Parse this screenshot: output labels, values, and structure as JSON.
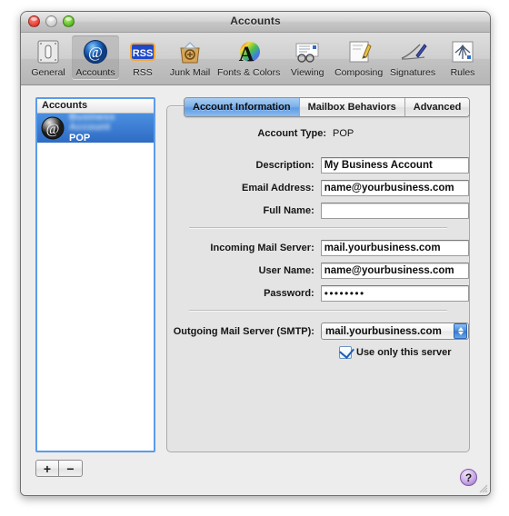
{
  "window": {
    "title": "Accounts",
    "traffic": {
      "close": "close-button",
      "minimize": "minimize-button",
      "zoom": "zoom-button"
    }
  },
  "toolbar": {
    "items": [
      {
        "label": "General",
        "icon": "general-icon",
        "selected": false
      },
      {
        "label": "Accounts",
        "icon": "accounts-at-icon",
        "selected": true
      },
      {
        "label": "RSS",
        "icon": "rss-icon",
        "selected": false
      },
      {
        "label": "Junk Mail",
        "icon": "junk-mail-icon",
        "selected": false
      },
      {
        "label": "Fonts & Colors",
        "icon": "fonts-colors-icon",
        "selected": false
      },
      {
        "label": "Viewing",
        "icon": "viewing-icon",
        "selected": false
      },
      {
        "label": "Composing",
        "icon": "composing-icon",
        "selected": false
      },
      {
        "label": "Signatures",
        "icon": "signatures-icon",
        "selected": false
      },
      {
        "label": "Rules",
        "icon": "rules-icon",
        "selected": false
      }
    ]
  },
  "sidebar": {
    "header": "Accounts",
    "account": {
      "name": "Business Account",
      "name_redacted": true,
      "type": "POP",
      "avatar_icon": "at-sign-avatar-icon"
    },
    "add_button": "+",
    "remove_button": "−"
  },
  "tabs": [
    {
      "label": "Account Information",
      "active": true
    },
    {
      "label": "Mailbox Behaviors",
      "active": false
    },
    {
      "label": "Advanced",
      "active": false
    }
  ],
  "form": {
    "account_type": {
      "label": "Account Type:",
      "value": "POP"
    },
    "description": {
      "label": "Description:",
      "value": "My Business Account",
      "placeholder": ""
    },
    "email_address": {
      "label": "Email Address:",
      "value": "name@yourbusiness.com",
      "placeholder": ""
    },
    "full_name": {
      "label": "Full Name:",
      "value": "",
      "placeholder": ""
    },
    "incoming_mail_server": {
      "label": "Incoming Mail Server:",
      "value": "mail.yourbusiness.com",
      "placeholder": ""
    },
    "user_name": {
      "label": "User Name:",
      "value": "name@yourbusiness.com",
      "placeholder": ""
    },
    "password": {
      "label": "Password:",
      "value": "••••••••"
    },
    "outgoing_mail_server": {
      "label": "Outgoing Mail Server (SMTP):",
      "selected": "mail.yourbusiness.com",
      "options": [
        "mail.yourbusiness.com"
      ]
    },
    "use_only_this_server": {
      "label": "Use only this server",
      "checked": true
    }
  },
  "help": {
    "label": "?",
    "icon": "help-question-icon"
  },
  "colors": {
    "selection_blue": "#2f6cc4",
    "tab_active_blue": "#7fb2ea",
    "focus_ring": "#5b9bea",
    "help_purple": "#9a6cc7",
    "window_bg": "#ededed"
  }
}
